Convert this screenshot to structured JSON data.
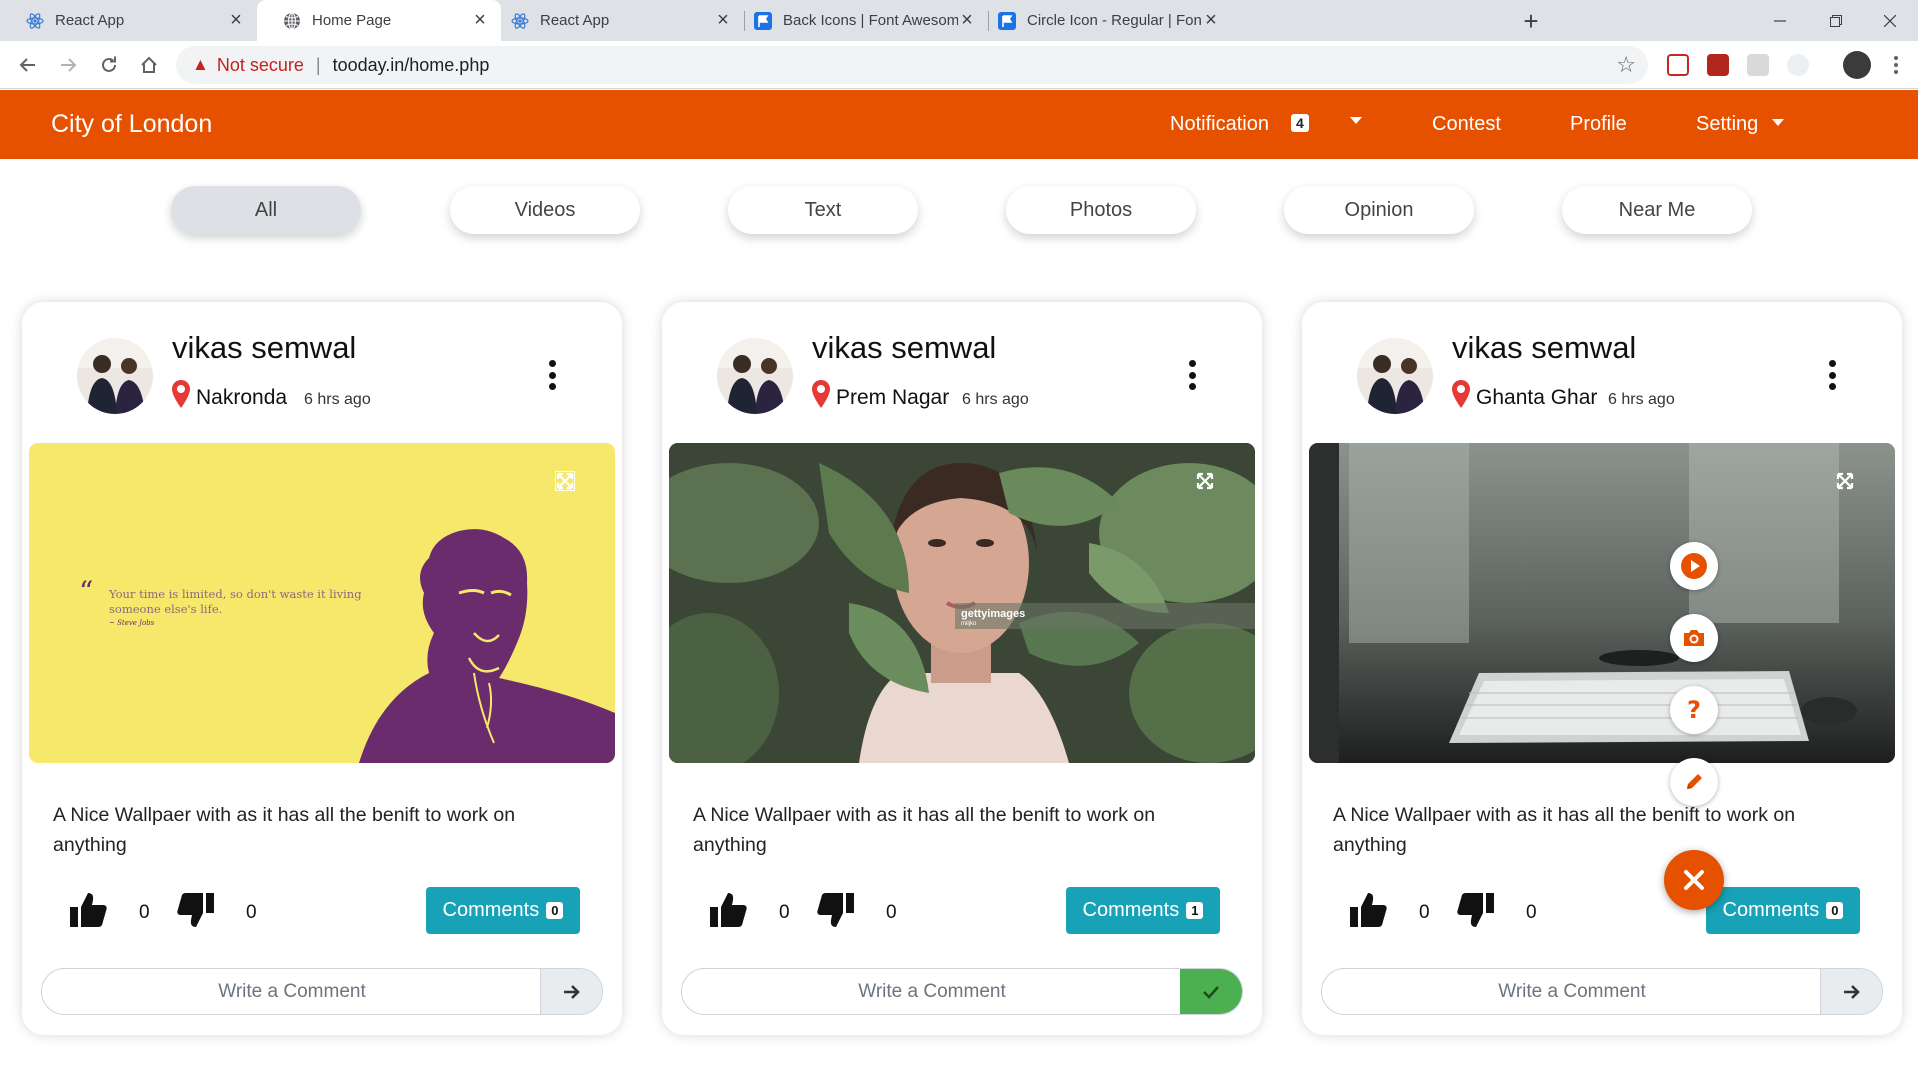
{
  "browser": {
    "tabs": [
      {
        "title": "React App",
        "icon": "react-icon",
        "active": false
      },
      {
        "title": "Home Page",
        "icon": "globe-icon",
        "active": true
      },
      {
        "title": "React App",
        "icon": "react-icon",
        "active": false
      },
      {
        "title": "Back Icons | Font Awesome",
        "icon": "flag-icon",
        "active": false
      },
      {
        "title": "Circle Icon - Regular | Font Awesome",
        "icon": "flag-icon",
        "active": false
      }
    ],
    "security_label": "Not secure",
    "url": "tooday.in/home.php"
  },
  "navbar": {
    "brand": "City of London",
    "notification_label": "Notification",
    "notification_count": "4",
    "contest_label": "Contest",
    "profile_label": "Profile",
    "setting_label": "Setting"
  },
  "filters": [
    "All",
    "Videos",
    "Text",
    "Photos",
    "Opinion",
    "Near Me"
  ],
  "posts": [
    {
      "author": "vikas semwal",
      "location": "Nakronda",
      "time": "6 hrs ago",
      "image": "steve-jobs-quote-wallpaper",
      "quote_text": "Your time is limited, so don't waste it living someone else's life.",
      "quote_author": "~ Steve Jobs",
      "description": "A Nice Wallpaer with as it has all the benift to work on anything",
      "likes": "0",
      "dislikes": "0",
      "comments_label": "Comments",
      "comments_count": "0",
      "comment_placeholder": "Write a Comment"
    },
    {
      "author": "vikas semwal",
      "location": "Prem Nagar",
      "time": "6 hrs ago",
      "image": "woman-behind-leaves-photo",
      "watermark": "gettyimages",
      "watermark_credit": "miljko",
      "description": "A Nice Wallpaer with as it has all the benift to work on anything",
      "likes": "0",
      "dislikes": "0",
      "comments_label": "Comments",
      "comments_count": "1",
      "comment_placeholder": "Write a Comment"
    },
    {
      "author": "vikas semwal",
      "location": "Ghanta Ghar",
      "time": "6 hrs ago",
      "image": "desk-keyboard-photo",
      "description": "A Nice Wallpaer with as it has all the benift to work on anything",
      "likes": "0",
      "dislikes": "0",
      "comments_label": "Comments",
      "comments_count": "0",
      "comment_placeholder": "Write a Comment"
    }
  ],
  "fab_menu": {
    "items": [
      "play-icon",
      "camera-icon",
      "question-icon",
      "pencil-icon"
    ],
    "main_icon": "close-icon"
  },
  "colors": {
    "accent": "#e65100",
    "comments_button": "#17a2b8",
    "submit_ok": "#4caf50",
    "location_pin": "#e53935"
  }
}
